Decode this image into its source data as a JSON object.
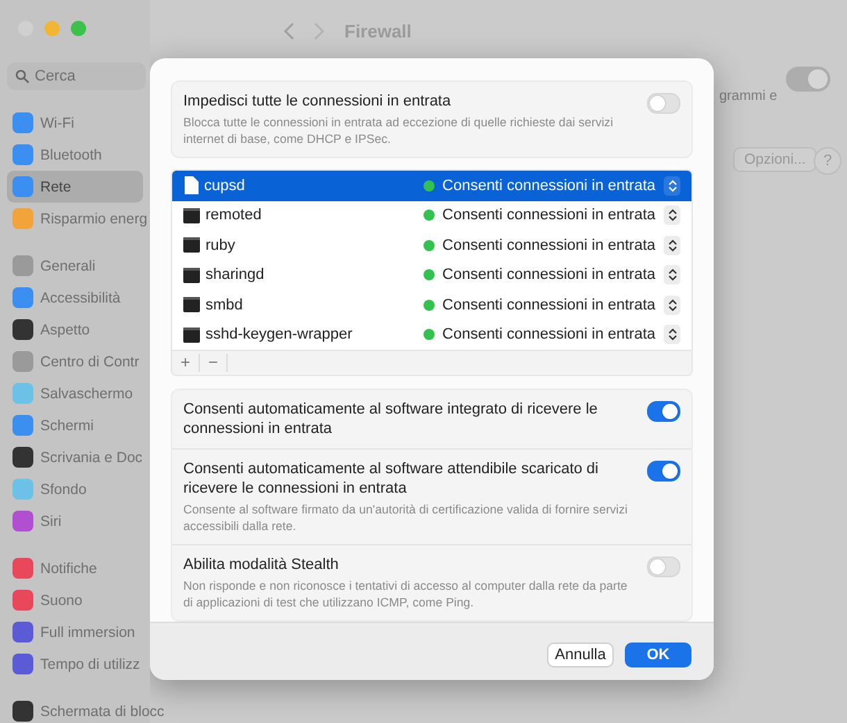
{
  "window": {
    "title": "Firewall"
  },
  "sidebar": {
    "search": {
      "placeholder": "Cerca"
    },
    "groups": [
      [
        {
          "label": "Wi-Fi",
          "color": "#3b8ff0",
          "selected": false
        },
        {
          "label": "Bluetooth",
          "color": "#3b8ff0",
          "selected": false
        },
        {
          "label": "Rete",
          "color": "#3b8ff0",
          "selected": true
        },
        {
          "label": "Risparmio energ",
          "color": "#f2a33a",
          "selected": false
        }
      ],
      [
        {
          "label": "Generali",
          "color": "#9a9a9a",
          "selected": false
        },
        {
          "label": "Accessibilità",
          "color": "#3b8ff0",
          "selected": false
        },
        {
          "label": "Aspetto",
          "color": "#333333",
          "selected": false
        },
        {
          "label": "Centro di Contr",
          "color": "#9a9a9a",
          "selected": false
        },
        {
          "label": "Salvaschermo",
          "color": "#6cc1e6",
          "selected": false
        },
        {
          "label": "Schermi",
          "color": "#3b8ff0",
          "selected": false
        },
        {
          "label": "Scrivania e Doc",
          "color": "#333333",
          "selected": false
        },
        {
          "label": "Sfondo",
          "color": "#6cc1e6",
          "selected": false
        },
        {
          "label": "Siri",
          "color": "#b04fd0",
          "selected": false
        }
      ],
      [
        {
          "label": "Notifiche",
          "color": "#e9485b",
          "selected": false
        },
        {
          "label": "Suono",
          "color": "#e9485b",
          "selected": false
        },
        {
          "label": "Full immersion",
          "color": "#5b5bd6",
          "selected": false
        },
        {
          "label": "Tempo di utilizz",
          "color": "#5b5bd6",
          "selected": false
        }
      ],
      [
        {
          "label": "Schermata di blocc",
          "color": "#333333",
          "selected": false
        }
      ]
    ]
  },
  "background": {
    "partial_text": "grammi e",
    "toggle_on": true,
    "options_button": "Opzioni...",
    "help_button": "?"
  },
  "dialog": {
    "block_all": {
      "title": "Impedisci tutte le connessioni in entrata",
      "description": "Blocca tutte le connessioni in entrata ad eccezione di quelle richieste dai servizi internet di base, come DHCP e IPSec.",
      "on": false
    },
    "apps": [
      {
        "name": "cupsd",
        "kind": "document",
        "status": "Consenti connessioni in entrata",
        "selected": true
      },
      {
        "name": "remoted",
        "kind": "terminal",
        "status": "Consenti connessioni in entrata",
        "selected": false
      },
      {
        "name": "ruby",
        "kind": "terminal",
        "status": "Consenti connessioni in entrata",
        "selected": false
      },
      {
        "name": "sharingd",
        "kind": "terminal",
        "status": "Consenti connessioni in entrata",
        "selected": false
      },
      {
        "name": "smbd",
        "kind": "terminal",
        "status": "Consenti connessioni in entrata",
        "selected": false
      },
      {
        "name": "sshd-keygen-wrapper",
        "kind": "terminal",
        "status": "Consenti connessioni in entrata",
        "selected": false
      }
    ],
    "list_buttons": [
      "+",
      "−"
    ],
    "options": [
      {
        "title": "Consenti automaticamente al software integrato di ricevere le connessioni in entrata",
        "on": true
      },
      {
        "title": "Consenti automaticamente al software attendibile scaricato di ricevere le connessioni in entrata",
        "description": "Consente al software firmato da un'autorità di certificazione valida di fornire servizi accessibili dalla rete.",
        "on": true
      },
      {
        "title": "Abilita modalità Stealth",
        "description": "Non risponde e non riconosce i tentativi di accesso al computer dalla rete da parte di applicazioni di test che utilizzano ICMP, come Ping.",
        "on": false
      }
    ],
    "buttons": [
      {
        "label": "Annulla",
        "kind": "secondary"
      },
      {
        "label": "OK",
        "kind": "primary"
      }
    ]
  }
}
